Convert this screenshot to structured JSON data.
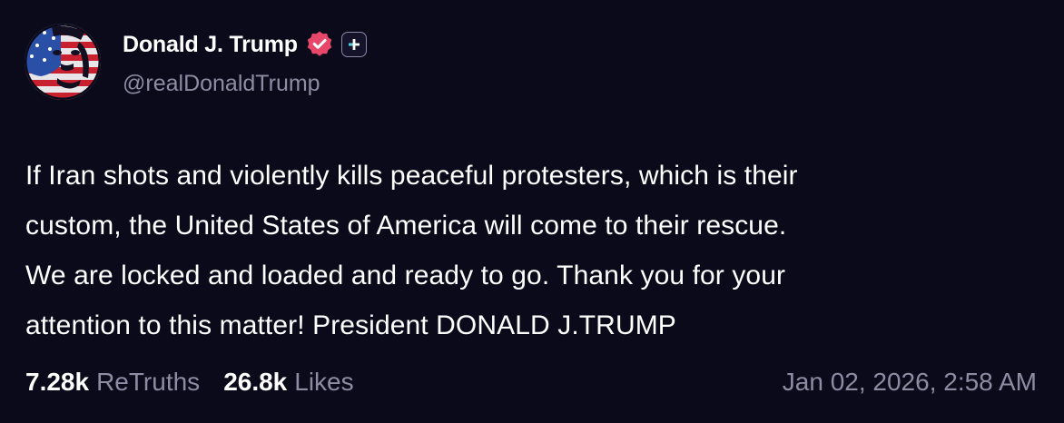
{
  "colors": {
    "background": "#0b0a1a",
    "text_primary": "#ffffff",
    "text_secondary": "#8e8ca3",
    "verified_badge": "#e8476a"
  },
  "author": {
    "display_name": "Donald J. Trump",
    "handle": "@realDonaldTrump",
    "avatar_icon": "avatar-flag-portrait",
    "verified_icon": "verified-badge-icon",
    "plus_icon": "plus-badge-icon"
  },
  "post": {
    "lines": [
      "If Iran shots and violently kills peaceful protesters, which is their",
      "custom, the United States of America will come to their rescue.",
      "We are locked and loaded and ready to go. Thank you for your",
      "attention to this matter! President DONALD J.TRUMP"
    ]
  },
  "stats": {
    "retruths_value": "7.28k",
    "retruths_label": "ReTruths",
    "likes_value": "26.8k",
    "likes_label": "Likes"
  },
  "timestamp": "Jan 02, 2026, 2:58 AM"
}
